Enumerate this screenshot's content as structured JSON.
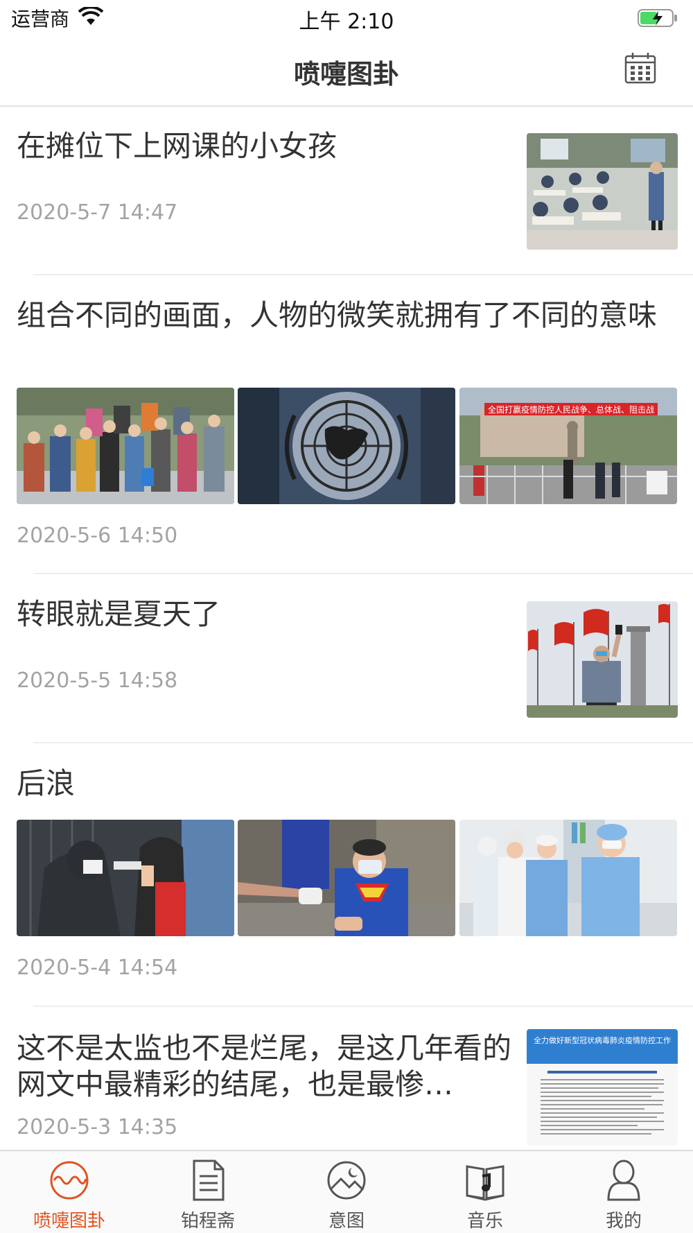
{
  "status_bar": {
    "carrier": "运营商",
    "time": "上午 2:10"
  },
  "nav": {
    "title": "喷嚏图卦",
    "calendar_icon": "calendar-icon"
  },
  "articles": [
    {
      "title": "在摊位下上网课的小女孩",
      "date": "2020-5-7 14:47"
    },
    {
      "title": "组合不同的画面，人物的微笑就拥有了不同的意味",
      "date": "2020-5-6 14:50"
    },
    {
      "title": "转眼就是夏天了",
      "date": "2020-5-5 14:58"
    },
    {
      "title": "后浪",
      "date": "2020-5-4 14:54"
    },
    {
      "title": "这不是太监也不是烂尾，是这几年看的网文中最精彩的结尾，也是最惨…",
      "date": "2020-5-3 14:35",
      "thumb_caption": "全力做好新型冠状病毒肺炎疫情防控工作"
    }
  ],
  "banner_text": "全国打赢疫情防控人民战争、总体战、阻击战",
  "tabs": [
    {
      "label": "喷嚏图卦",
      "icon": "wave-circle-icon",
      "active": true
    },
    {
      "label": "铂程斋",
      "icon": "document-icon",
      "active": false
    },
    {
      "label": "意图",
      "icon": "picture-moon-icon",
      "active": false
    },
    {
      "label": "音乐",
      "icon": "music-book-icon",
      "active": false
    },
    {
      "label": "我的",
      "icon": "person-icon",
      "active": false
    }
  ],
  "colors": {
    "accent": "#e0531e",
    "text": "#333333",
    "date": "#a3a3a3",
    "divider": "#eeeeee"
  }
}
